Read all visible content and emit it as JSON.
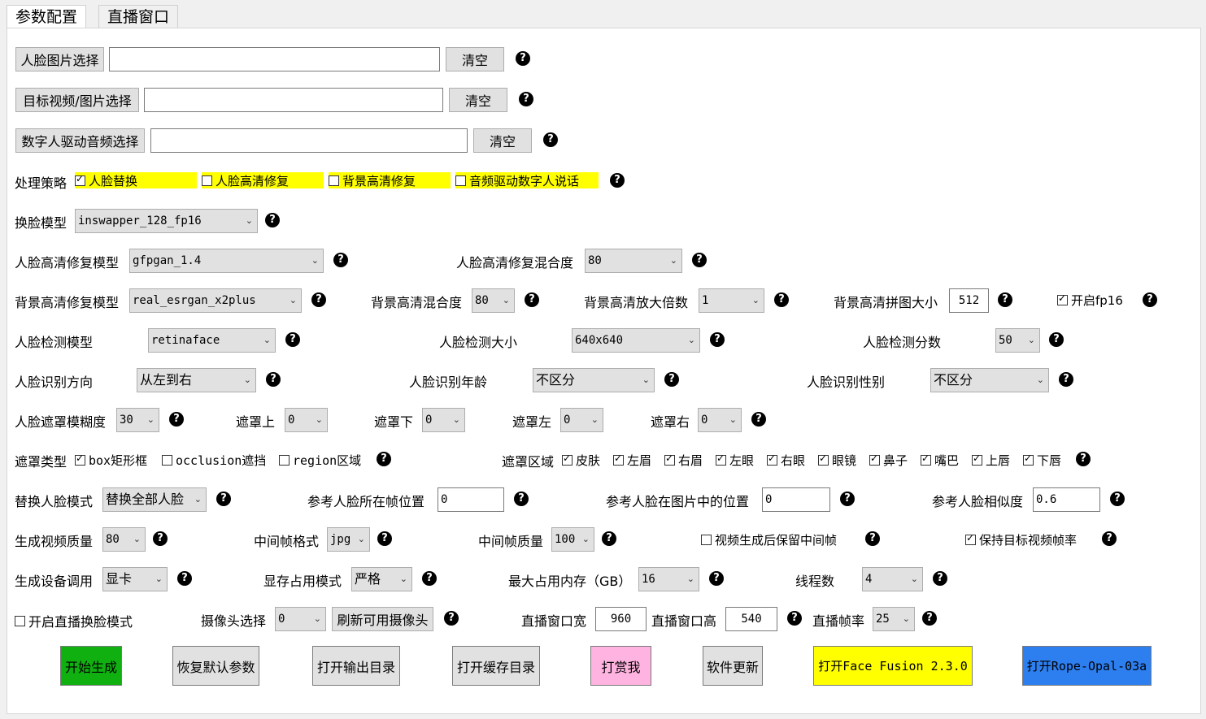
{
  "tabs": [
    "参数配置",
    "直播窗口"
  ],
  "rows": {
    "face_image": {
      "button": "人脸图片选择",
      "value": "",
      "clear": "清空"
    },
    "target": {
      "button": "目标视频/图片选择",
      "value": "",
      "clear": "清空"
    },
    "audio": {
      "button": "数字人驱动音频选择",
      "value": "",
      "clear": "清空"
    },
    "strategy": {
      "label": "处理策略",
      "options": [
        {
          "label": "人脸替换",
          "checked": true
        },
        {
          "label": "人脸高清修复",
          "checked": false
        },
        {
          "label": "背景高清修复",
          "checked": false
        },
        {
          "label": "音频驱动数字人说话",
          "checked": false
        }
      ]
    },
    "swap_model": {
      "label": "换脸模型",
      "value": "inswapper_128_fp16"
    },
    "face_enhance": {
      "label": "人脸高清修复模型",
      "value": "gfpgan_1.4",
      "blend_label": "人脸高清修复混合度",
      "blend_value": "80"
    },
    "bg_enhance": {
      "label": "背景高清修复模型",
      "value": "real_esrgan_x2plus",
      "blend_label": "背景高清混合度",
      "blend_value": "80",
      "scale_label": "背景高清放大倍数",
      "scale_value": "1",
      "tile_label": "背景高清拼图大小",
      "tile_value": "512",
      "fp16_label": "开启fp16",
      "fp16_checked": true
    },
    "detect": {
      "label": "人脸检测模型",
      "value": "retinaface",
      "size_label": "人脸检测大小",
      "size_value": "640x640",
      "score_label": "人脸检测分数",
      "score_value": "50"
    },
    "recog": {
      "label": "人脸识别方向",
      "value": "从左到右",
      "age_label": "人脸识别年龄",
      "age_value": "不区分",
      "gender_label": "人脸识别性别",
      "gender_value": "不区分"
    },
    "mask": {
      "label": "人脸遮罩模糊度",
      "value": "30",
      "top_label": "遮罩上",
      "top_value": "0",
      "bottom_label": "遮罩下",
      "bottom_value": "0",
      "left_label": "遮罩左",
      "left_value": "0",
      "right_label": "遮罩右",
      "right_value": "0"
    },
    "mask_type": {
      "label": "遮罩类型",
      "types": [
        {
          "label": "box矩形框",
          "checked": true
        },
        {
          "label": "occlusion遮挡",
          "checked": false
        },
        {
          "label": "region区域",
          "checked": false
        }
      ],
      "region_label": "遮罩区域",
      "regions": [
        {
          "label": "皮肤",
          "checked": true
        },
        {
          "label": "左眉",
          "checked": true
        },
        {
          "label": "右眉",
          "checked": true
        },
        {
          "label": "左眼",
          "checked": true
        },
        {
          "label": "右眼",
          "checked": true
        },
        {
          "label": "眼镜",
          "checked": true
        },
        {
          "label": "鼻子",
          "checked": true
        },
        {
          "label": "嘴巴",
          "checked": true
        },
        {
          "label": "上唇",
          "checked": true
        },
        {
          "label": "下唇",
          "checked": true
        }
      ]
    },
    "replace": {
      "label": "替换人脸模式",
      "value": "替换全部人脸",
      "frame_label": "参考人脸所在帧位置",
      "frame_value": "0",
      "pos_label": "参考人脸在图片中的位置",
      "pos_value": "0",
      "sim_label": "参考人脸相似度",
      "sim_value": "0.6"
    },
    "quality": {
      "label": "生成视频质量",
      "value": "80",
      "fmt_label": "中间帧格式",
      "fmt_value": "jpg",
      "fq_label": "中间帧质量",
      "fq_value": "100",
      "keep_label": "视频生成后保留中间帧",
      "keep_checked": false,
      "fps_label": "保持目标视频帧率",
      "fps_checked": true
    },
    "device": {
      "label": "生成设备调用",
      "value": "显卡",
      "mem_label": "显存占用模式",
      "mem_value": "严格",
      "max_label": "最大占用内存（GB）",
      "max_value": "16",
      "threads_label": "线程数",
      "threads_value": "4"
    },
    "live": {
      "label": "开启直播换脸模式",
      "checked": false,
      "cam_label": "摄像头选择",
      "cam_value": "0",
      "refresh": "刷新可用摄像头",
      "w_label": "直播窗口宽",
      "w_value": "960",
      "h_label": "直播窗口高",
      "h_value": "540",
      "fps_label": "直播帧率",
      "fps_value": "25"
    }
  },
  "actions": [
    {
      "label": "开始生成",
      "color": "#10b010"
    },
    {
      "label": "恢复默认参数",
      "color": "#e1e1e1"
    },
    {
      "label": "打开输出目录",
      "color": "#e1e1e1"
    },
    {
      "label": "打开缓存目录",
      "color": "#e1e1e1"
    },
    {
      "label": "打赏我",
      "color": "#ffb3e0"
    },
    {
      "label": "软件更新",
      "color": "#e1e1e1"
    },
    {
      "label": "打开Face Fusion 2.3.0",
      "color": "#ffff00"
    },
    {
      "label": "打开Rope-Opal-03a",
      "color": "#2d7ff0"
    }
  ],
  "help_symbol": "?",
  "arrow_symbol": "⌄"
}
